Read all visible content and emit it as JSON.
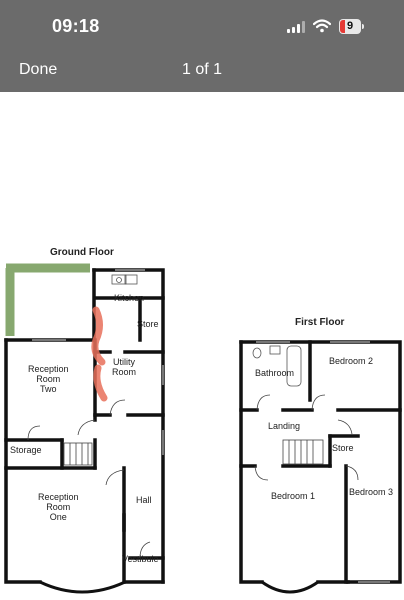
{
  "status_bar": {
    "time": "09:18",
    "battery_level": "9",
    "icons": [
      "cellular-signal-icon",
      "wifi-icon",
      "battery-icon"
    ]
  },
  "nav": {
    "done_label": "Done",
    "page_indicator": "1 of 1"
  },
  "floorplan": {
    "ground_floor": {
      "title": "Ground Floor",
      "rooms": {
        "kitchen": "Kitchen",
        "store": "Store",
        "utility": "Utility\nRoom",
        "reception_two": "Reception\nRoom\nTwo",
        "storage": "Storage",
        "reception_one": "Reception\nRoom\nOne",
        "hall": "Hall",
        "vestibule": "Vestibule"
      }
    },
    "first_floor": {
      "title": "First Floor",
      "rooms": {
        "bathroom": "Bathroom",
        "bedroom2": "Bedroom 2",
        "landing": "Landing",
        "store": "Store",
        "bedroom1": "Bedroom 1",
        "bedroom3": "Bedroom 3"
      }
    },
    "colors": {
      "wall": "#111111",
      "green_markup": "#7a9e5f",
      "red_markup": "#e8705a"
    }
  }
}
